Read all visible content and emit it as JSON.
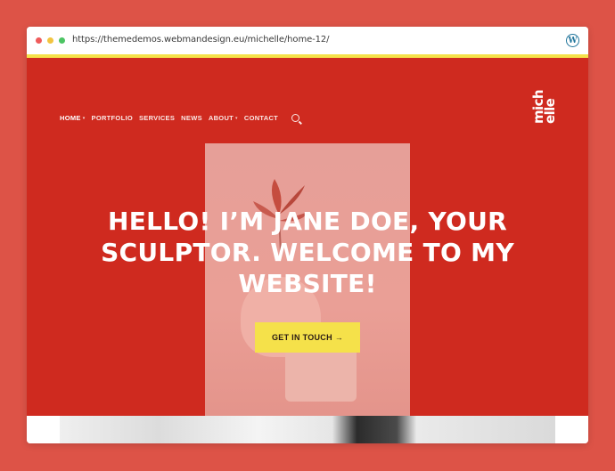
{
  "browser": {
    "url": "https://themedemos.webmandesign.eu/michelle/home-12/",
    "wp_icon_glyph": "W"
  },
  "nav": {
    "items": [
      {
        "label": "HOME",
        "has_dropdown": true,
        "active": true
      },
      {
        "label": "PORTFOLIO",
        "has_dropdown": false,
        "active": false
      },
      {
        "label": "SERVICES",
        "has_dropdown": false,
        "active": false
      },
      {
        "label": "NEWS",
        "has_dropdown": false,
        "active": false
      },
      {
        "label": "ABOUT",
        "has_dropdown": true,
        "active": false
      },
      {
        "label": "CONTACT",
        "has_dropdown": false,
        "active": false
      }
    ],
    "caret": "▾"
  },
  "logo": {
    "line1": "mich",
    "line2": "elle"
  },
  "hero": {
    "title": "HELLO! I’M JANE DOE, YOUR SCULPTOR. WELCOME TO MY WEBSITE!",
    "cta_label": "GET IN TOUCH →"
  },
  "colors": {
    "page_background": "#dd5347",
    "site_background": "#cf2a1f",
    "accent_yellow": "#f5e14a"
  }
}
